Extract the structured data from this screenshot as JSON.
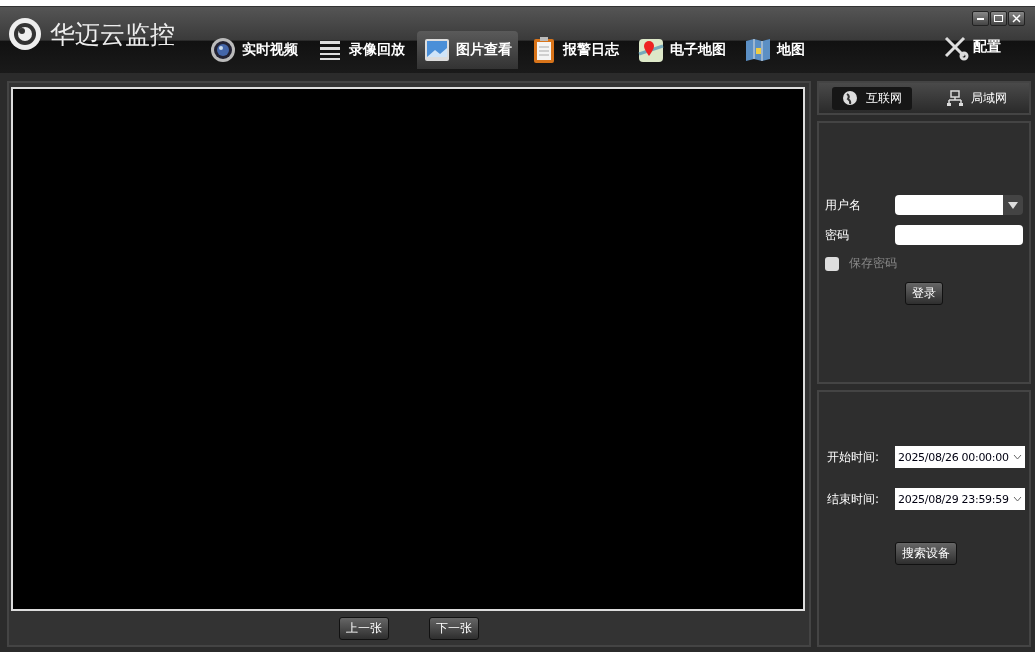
{
  "window": {
    "title": "华迈云监控"
  },
  "nav": [
    {
      "label": "实时视频",
      "kind": "camera",
      "selected": false
    },
    {
      "label": "录像回放",
      "kind": "clapper",
      "selected": false
    },
    {
      "label": "图片查看",
      "kind": "picture",
      "selected": true
    },
    {
      "label": "报警日志",
      "kind": "clipboard",
      "selected": false
    },
    {
      "label": "电子地图",
      "kind": "pin",
      "selected": false
    },
    {
      "label": "地图",
      "kind": "map",
      "selected": false
    }
  ],
  "settings": {
    "label": "配置"
  },
  "viewer": {
    "buttons": [
      "上一张",
      "下一张"
    ]
  },
  "network_tabs": [
    {
      "label": "互联网",
      "kind": "globe",
      "selected": true
    },
    {
      "label": "局域网",
      "kind": "lan",
      "selected": false
    }
  ],
  "login": {
    "username_label": "用户名",
    "password_label": "密码",
    "remember": {
      "label": "保存密码",
      "checked": false
    },
    "button": "登录"
  },
  "search": {
    "start_label": "开始时间:",
    "start_value": "2025/08/26 00:00:00",
    "end_label": "结束时间:",
    "end_value": "2025/08/29 23:59:59",
    "button": "搜索设备"
  }
}
